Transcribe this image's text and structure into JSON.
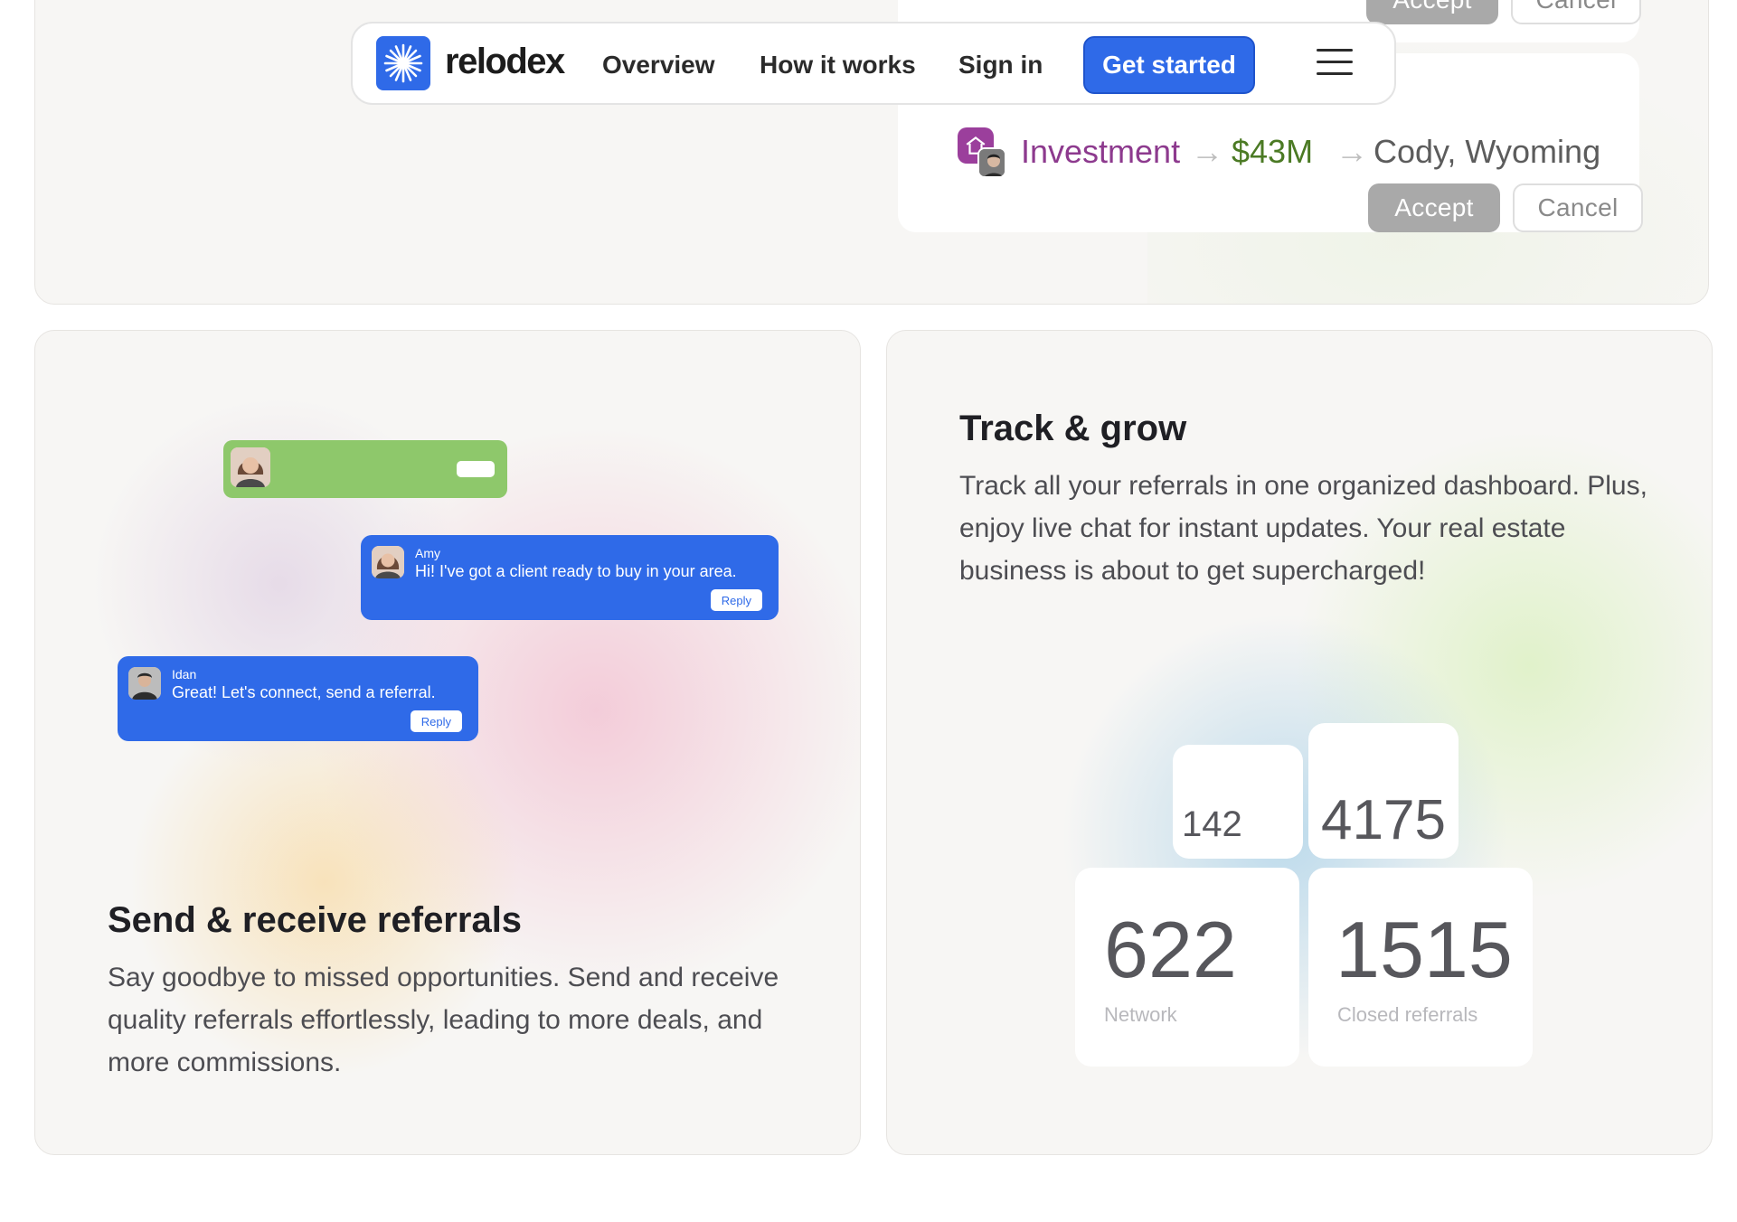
{
  "colors": {
    "brand_blue": "#2f6ae8",
    "investment_purple": "#8d3a8e",
    "amount_green": "#4b7a24",
    "chat_green": "#8ec86b",
    "accept_gray": "#a9a9a9"
  },
  "navbar": {
    "logo_icon": "asterisk-burst-icon",
    "brand": "relodex",
    "links": [
      "Overview",
      "How it works",
      "Sign in"
    ],
    "cta": "Get started",
    "menu_icon": "hamburger-menu-icon"
  },
  "referral_cards": {
    "previous": {
      "accept": "Accept",
      "cancel": "Cancel"
    },
    "current": {
      "type": "Investment",
      "amount": "$43M",
      "location": "Cody, Wyoming",
      "arrow_icon": "arrow-right-icon",
      "badge_icon": "house-icon",
      "accept": "Accept",
      "cancel": "Cancel"
    }
  },
  "send_receive": {
    "chat_amy": {
      "name": "Amy",
      "message": "Hi! I've got a client ready to buy in your area.",
      "reply": "Reply"
    },
    "chat_idan": {
      "name": "Idan",
      "message": "Great! Let's connect, send a referral.",
      "reply": "Reply"
    },
    "title": "Send & receive referrals",
    "body": "Say goodbye to missed opportunities. Send and receive quality referrals effortlessly, leading to more deals, and more commissions."
  },
  "track_grow": {
    "title": "Track & grow",
    "body": "Track all your referrals in one organized dashboard. Plus, enjoy live chat for instant updates. Your real estate business is about to get supercharged!",
    "stats": {
      "small_a": "142",
      "small_b": "4175",
      "network_value": "622",
      "network_label": "Network",
      "closed_value": "1515",
      "closed_label": "Closed referrals"
    }
  }
}
